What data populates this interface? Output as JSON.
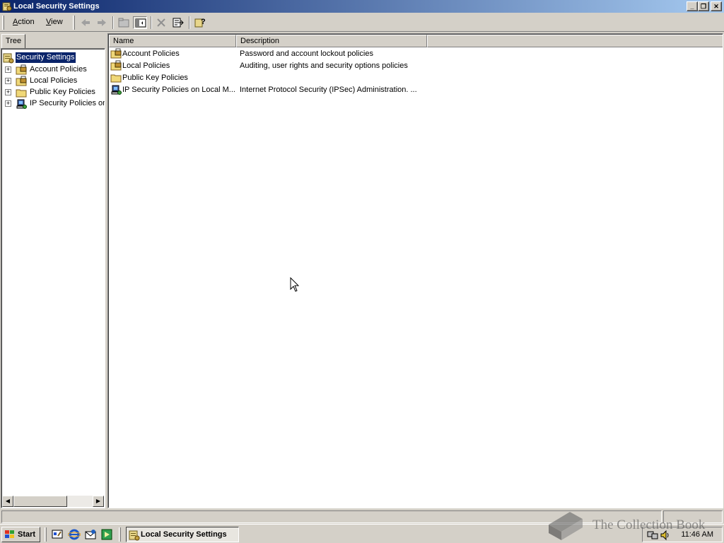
{
  "window": {
    "title": "Local Security Settings",
    "controls": {
      "minimize": "_",
      "restore": "❐",
      "close": "✕"
    }
  },
  "menubar": {
    "items": [
      {
        "label": "Action",
        "accesskey": "A"
      },
      {
        "label": "View",
        "accesskey": "V"
      }
    ]
  },
  "toolbar": {
    "icons": [
      "back-icon",
      "forward-icon",
      "up-folder-icon",
      "show-hide-tree-icon",
      "delete-icon",
      "export-list-icon",
      "help-icon"
    ]
  },
  "tree": {
    "tab_label": "Tree",
    "root": "Security Settings",
    "items": [
      {
        "label": "Account Policies",
        "icon": "locked-folder-icon"
      },
      {
        "label": "Local Policies",
        "icon": "locked-folder-icon"
      },
      {
        "label": "Public Key Policies",
        "icon": "folder-icon"
      },
      {
        "label": "IP Security Policies on",
        "icon": "ip-security-icon"
      }
    ]
  },
  "list": {
    "columns": [
      "Name",
      "Description"
    ],
    "rows": [
      {
        "name": "Account Policies",
        "description": "Password and account lockout policies",
        "icon": "locked-folder-icon"
      },
      {
        "name": "Local Policies",
        "description": "Auditing, user rights and security options policies",
        "icon": "locked-folder-icon"
      },
      {
        "name": "Public Key Policies",
        "description": "",
        "icon": "folder-icon"
      },
      {
        "name": "IP Security Policies on Local M...",
        "description": "Internet Protocol Security (IPSec) Administration. ...",
        "icon": "ip-security-icon"
      }
    ]
  },
  "taskbar": {
    "start_label": "Start",
    "active_task": "Local Security Settings",
    "clock": "11:46 AM"
  },
  "watermark": {
    "text": "The Collection Book"
  },
  "colors": {
    "title_start": "#0a246a",
    "title_end": "#a6caf0",
    "face": "#d4d0c8",
    "selection": "#0a246a"
  }
}
